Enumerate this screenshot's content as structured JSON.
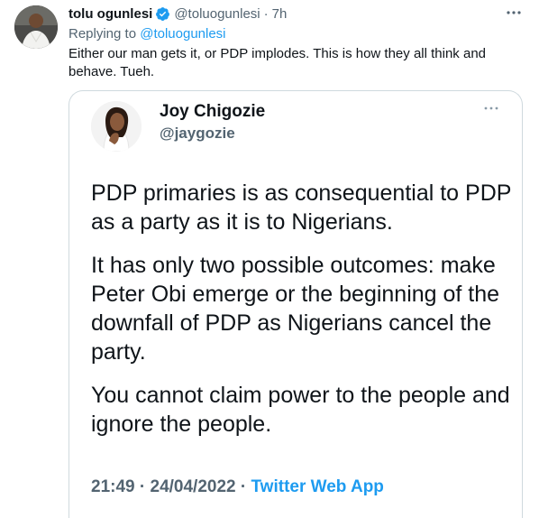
{
  "author": {
    "display_name": "tolu ogunlesi",
    "handle": "@toluogunlesi",
    "separator": "·",
    "time": "7h",
    "verified": true
  },
  "reply": {
    "prefix": "Replying to",
    "to_handle": "@toluogunlesi"
  },
  "tweet_text": "Either our man gets it, or PDP implodes. This is how they all think and behave. Tueh.",
  "icons": {
    "more": "more-horizontal-icon",
    "verified": "verified-badge-icon"
  },
  "quoted": {
    "display_name": "Joy Chigozie",
    "handle": "@jaygozie",
    "paragraphs": [
      "PDP primaries is as consequential to PDP as a party as it is to Nigerians.",
      "It has only two possible outcomes: make Peter Obi emerge or the beginning of the downfall of PDP as Nigerians cancel the party.",
      "You cannot claim power to the people and ignore the people."
    ],
    "time": "21:49",
    "separator": "·",
    "date": "24/04/2022",
    "source": "Twitter Web App"
  },
  "colors": {
    "link": "#1d9bf0",
    "secondary_text": "#536471",
    "primary_text": "#0f1419",
    "border": "#cfd9de"
  }
}
